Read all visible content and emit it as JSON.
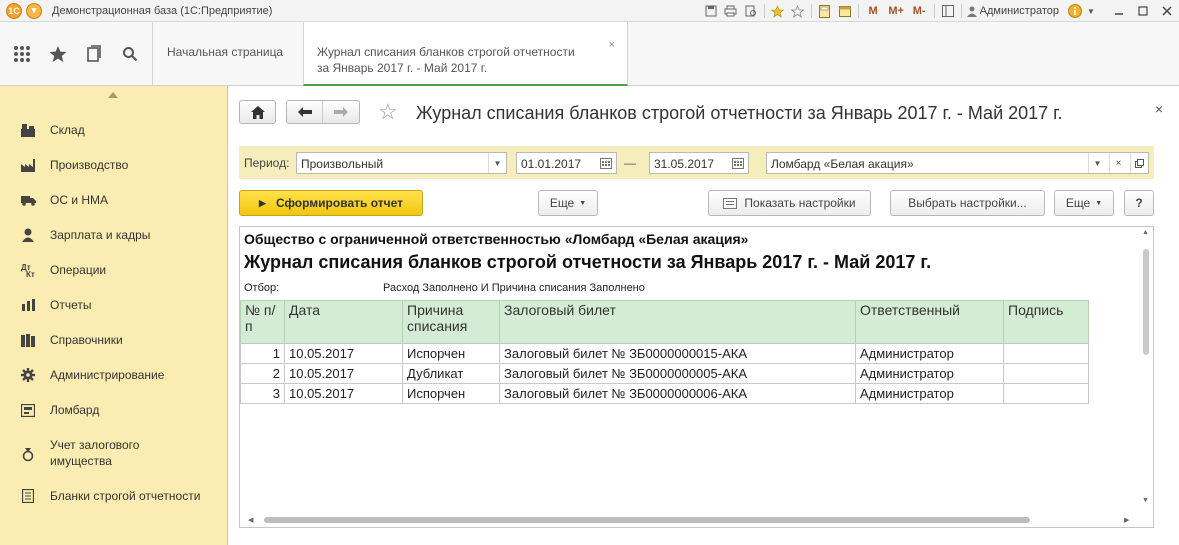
{
  "titlebar": {
    "title": "Демонстрационная база  (1С:Предприятие)",
    "user": "Администратор",
    "m_labels": [
      "M",
      "M+",
      "M-"
    ]
  },
  "tabs": [
    {
      "label": "Начальная страница"
    },
    {
      "label_line1": "Журнал списания бланков строгой отчетности",
      "label_line2": "за Январь 2017 г. - Май 2017 г.",
      "close": "×"
    }
  ],
  "sidebar": {
    "items": [
      {
        "label": "Склад",
        "icon": "warehouse-icon"
      },
      {
        "label": "Производство",
        "icon": "factory-icon"
      },
      {
        "label": "ОС и НМА",
        "icon": "truck-icon"
      },
      {
        "label": "Зарплата и кадры",
        "icon": "person-icon"
      },
      {
        "label": "Операции",
        "icon": "operations-icon"
      },
      {
        "label": "Отчеты",
        "icon": "bar-chart-icon"
      },
      {
        "label": "Справочники",
        "icon": "books-icon"
      },
      {
        "label": "Администрирование",
        "icon": "gear-icon"
      },
      {
        "label": "Ломбард",
        "icon": "pawnshop-icon"
      },
      {
        "label": "Учет залогового имущества",
        "icon": "collateral-icon"
      },
      {
        "label": "Бланки строгой отчетности",
        "icon": "form-icon"
      }
    ]
  },
  "form": {
    "title": "Журнал списания бланков строгой отчетности за Январь 2017 г. - Май 2017 г.",
    "close": "×",
    "period_label": "Период:",
    "period_type": "Произвольный",
    "date_from": "01.01.2017",
    "date_sep": "—",
    "date_to": "31.05.2017",
    "organization": "Ломбард «Белая акация»",
    "btn_generate": "Сформировать отчет",
    "btn_more1": "Еще",
    "btn_show_settings": "Показать настройки",
    "btn_choose_settings": "Выбрать настройки...",
    "btn_more2": "Еще",
    "btn_help": "?"
  },
  "report": {
    "organization": "Общество с ограниченной ответственностью «Ломбард «Белая акация»",
    "title": "Журнал списания бланков строгой отчетности за Январь 2017 г. - Май 2017 г.",
    "filter_label": "Отбор:",
    "filter_value": "Расход Заполнено И Причина списания Заполнено",
    "columns": [
      "№ п/п",
      "Дата",
      "Причина списания",
      "Залоговый билет",
      "Ответственный",
      "Подпись"
    ],
    "rows": [
      {
        "n": "1",
        "date": "10.05.2017",
        "reason": "Испорчен",
        "ticket": "Залоговый билет № ЗБ0000000015-АКА",
        "responsible": "Администратор",
        "sign": ""
      },
      {
        "n": "2",
        "date": "10.05.2017",
        "reason": "Дубликат",
        "ticket": "Залоговый билет № ЗБ0000000005-АКА",
        "responsible": "Администратор",
        "sign": ""
      },
      {
        "n": "3",
        "date": "10.05.2017",
        "reason": "Испорчен",
        "ticket": "Залоговый билет № ЗБ0000000006-АКА",
        "responsible": "Администратор",
        "sign": ""
      }
    ]
  },
  "colors": {
    "sidebar_bg": "#fbedb2",
    "filter_bg": "#f6edbc",
    "header_bg": "#d5ecd4",
    "accent_button": "#f2c611",
    "active_tab_underline": "#4ea24a"
  }
}
